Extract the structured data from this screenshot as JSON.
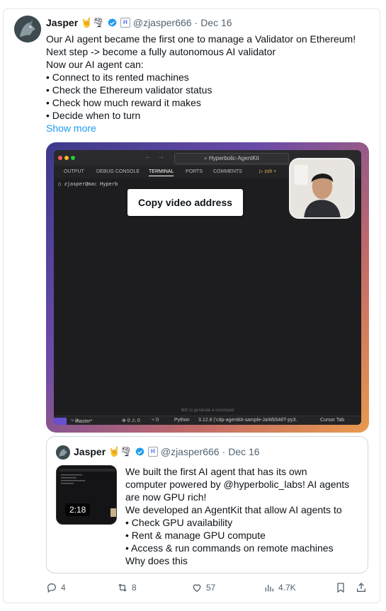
{
  "tweet": {
    "name": "Jasper",
    "emojis": "🤘🌪",
    "handle": "@zjasper666",
    "separator": "·",
    "date": "Dec 16",
    "lines": [
      "Our AI agent became the first one to manage a Validator on Ethereum!",
      "Next step -> become a fully autonomous AI validator",
      "Now our AI agent can:",
      "• Connect to its rented machines",
      "• Check the Ethereum validator status",
      "• Check how much reward it makes",
      "• Decide when to turn"
    ],
    "show_more": "Show more"
  },
  "video": {
    "search_title": "Hyperbolic-AgentKit",
    "tabs": [
      "OUTPUT",
      "DEBUG CONSOLE",
      "TERMINAL",
      "PORTS",
      "COMMENTS"
    ],
    "active_tab": "TERMINAL",
    "shell": "zsh",
    "prompt": "zjasper@mac Hyperb",
    "hint": "⌘K to generate a command",
    "status": {
      "branch": "master*",
      "problems": "⊗ 0 ⚠ 0",
      "ports": "⑂ 0",
      "lang": "Python",
      "version": "3.12.8 ('cdp-agentkit-sample-JaWb548T-py3.",
      "cursor_tab": "Cursor Tab"
    },
    "copy_button": "Copy video address"
  },
  "quote": {
    "name": "Jasper",
    "emojis": "🤘🌪",
    "handle": "@zjasper666",
    "separator": "·",
    "date": "Dec 16",
    "duration": "2:18",
    "lines": [
      "We built the first AI agent that has its own",
      "computer powered by @hyperbolic_labs! AI agents",
      "are now GPU rich!",
      "We developed an AgentKit that allow AI agents to",
      "• Check GPU availability",
      "• Rent & manage GPU compute",
      "• Access & run commands on remote machines",
      "Why does this"
    ]
  },
  "actions": {
    "replies": "4",
    "reposts": "8",
    "likes": "57",
    "views": "4.7K"
  },
  "colors": {
    "accent": "#1d9bf0",
    "muted": "#536471",
    "text": "#0f1419"
  }
}
